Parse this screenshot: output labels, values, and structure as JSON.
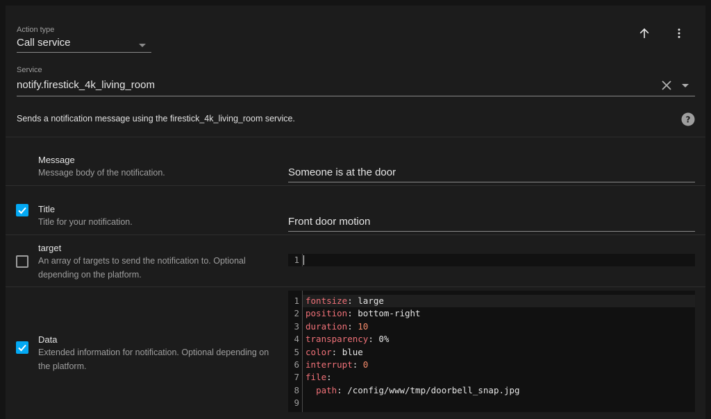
{
  "action_type": {
    "label": "Action type",
    "value": "Call service"
  },
  "service": {
    "label": "Service",
    "value": "notify.firestick_4k_living_room",
    "description": "Sends a notification message using the firestick_4k_living_room service."
  },
  "fields": [
    {
      "name": "Message",
      "description": "Message body of the notification.",
      "checked": null,
      "value": "Someone is at the door"
    },
    {
      "name": "Title",
      "description": "Title for your notification.",
      "checked": true,
      "value": "Front door motion"
    },
    {
      "name": "target",
      "description": "An array of targets to send the notification to. Optional depending on the platform.",
      "checked": false,
      "code_lines": [
        ""
      ]
    },
    {
      "name": "Data",
      "description": "Extended information for notification. Optional depending on the platform.",
      "checked": true,
      "code_lines": [
        {
          "key": "fontsize",
          "value": "large",
          "type": "str"
        },
        {
          "key": "position",
          "value": "bottom-right",
          "type": "str"
        },
        {
          "key": "duration",
          "value": "10",
          "type": "num"
        },
        {
          "key": "transparency",
          "value": "0%",
          "type": "str"
        },
        {
          "key": "color",
          "value": "blue",
          "type": "str"
        },
        {
          "key": "interrupt",
          "value": "0",
          "type": "num"
        },
        {
          "key": "file",
          "value": "",
          "type": "obj"
        },
        {
          "key": "  path",
          "value": "/config/www/tmp/doorbell_snap.jpg",
          "type": "str"
        },
        {
          "key": "",
          "value": "",
          "type": "empty"
        }
      ]
    }
  ],
  "colors": {
    "accent": "#03a9f4",
    "yaml_key": "#f07178",
    "yaml_number": "#f78c6c"
  },
  "icons": {
    "move_up": "arrow-up-icon",
    "more": "dots-vertical-icon",
    "clear": "close-icon",
    "dropdown": "menu-down-icon",
    "help": "help-circle-icon"
  }
}
